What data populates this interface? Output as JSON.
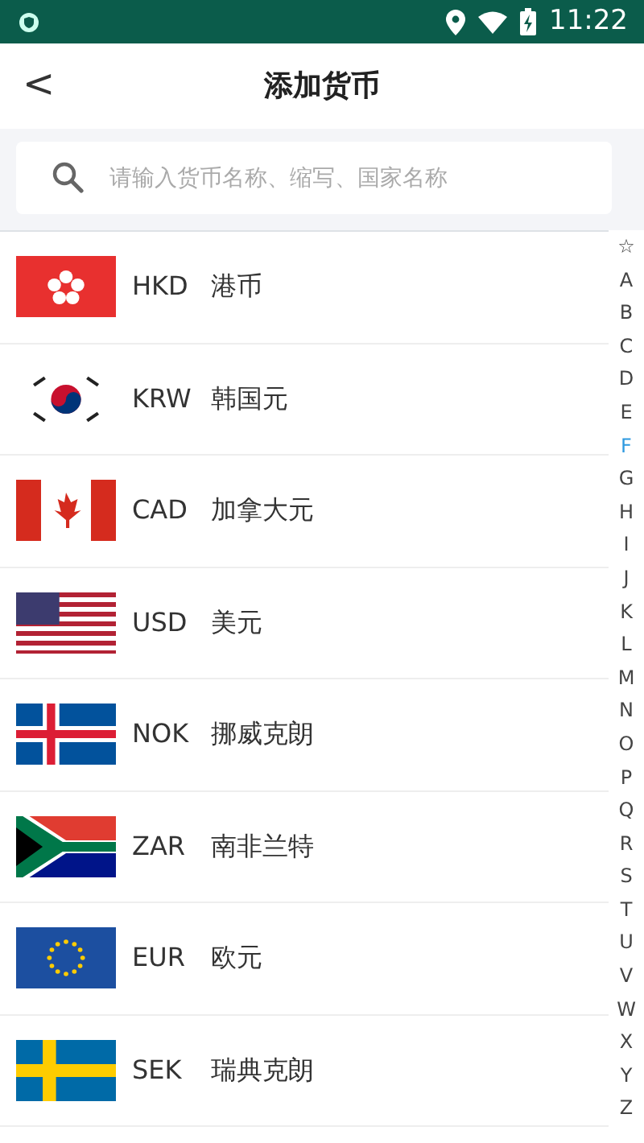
{
  "status_bar": {
    "time": "11:22"
  },
  "header": {
    "back": "<",
    "title": "添加货币"
  },
  "search": {
    "placeholder": "请输入货币名称、缩写、国家名称"
  },
  "currencies": [
    {
      "kind": "hk",
      "code": "HKD",
      "name": "港币"
    },
    {
      "kind": "kr",
      "code": "KRW",
      "name": "韩国元"
    },
    {
      "kind": "ca",
      "code": "CAD",
      "name": "加拿大元"
    },
    {
      "kind": "us",
      "code": "USD",
      "name": "美元"
    },
    {
      "kind": "is",
      "code": "NOK",
      "name": "挪威克朗"
    },
    {
      "kind": "za",
      "code": "ZAR",
      "name": "南非兰特"
    },
    {
      "kind": "eu",
      "code": "EUR",
      "name": "欧元"
    },
    {
      "kind": "se",
      "code": "SEK",
      "name": "瑞典克朗"
    }
  ],
  "index": [
    {
      "label": "☆",
      "selected": false
    },
    {
      "label": "A",
      "selected": false
    },
    {
      "label": "B",
      "selected": false
    },
    {
      "label": "C",
      "selected": false
    },
    {
      "label": "D",
      "selected": false
    },
    {
      "label": "E",
      "selected": false
    },
    {
      "label": "F",
      "selected": true
    },
    {
      "label": "G",
      "selected": false
    },
    {
      "label": "H",
      "selected": false
    },
    {
      "label": "I",
      "selected": false
    },
    {
      "label": "J",
      "selected": false
    },
    {
      "label": "K",
      "selected": false
    },
    {
      "label": "L",
      "selected": false
    },
    {
      "label": "M",
      "selected": false
    },
    {
      "label": "N",
      "selected": false
    },
    {
      "label": "O",
      "selected": false
    },
    {
      "label": "P",
      "selected": false
    },
    {
      "label": "Q",
      "selected": false
    },
    {
      "label": "R",
      "selected": false
    },
    {
      "label": "S",
      "selected": false
    },
    {
      "label": "T",
      "selected": false
    },
    {
      "label": "U",
      "selected": false
    },
    {
      "label": "V",
      "selected": false
    },
    {
      "label": "W",
      "selected": false
    },
    {
      "label": "X",
      "selected": false
    },
    {
      "label": "Y",
      "selected": false
    },
    {
      "label": "Z",
      "selected": false
    }
  ]
}
